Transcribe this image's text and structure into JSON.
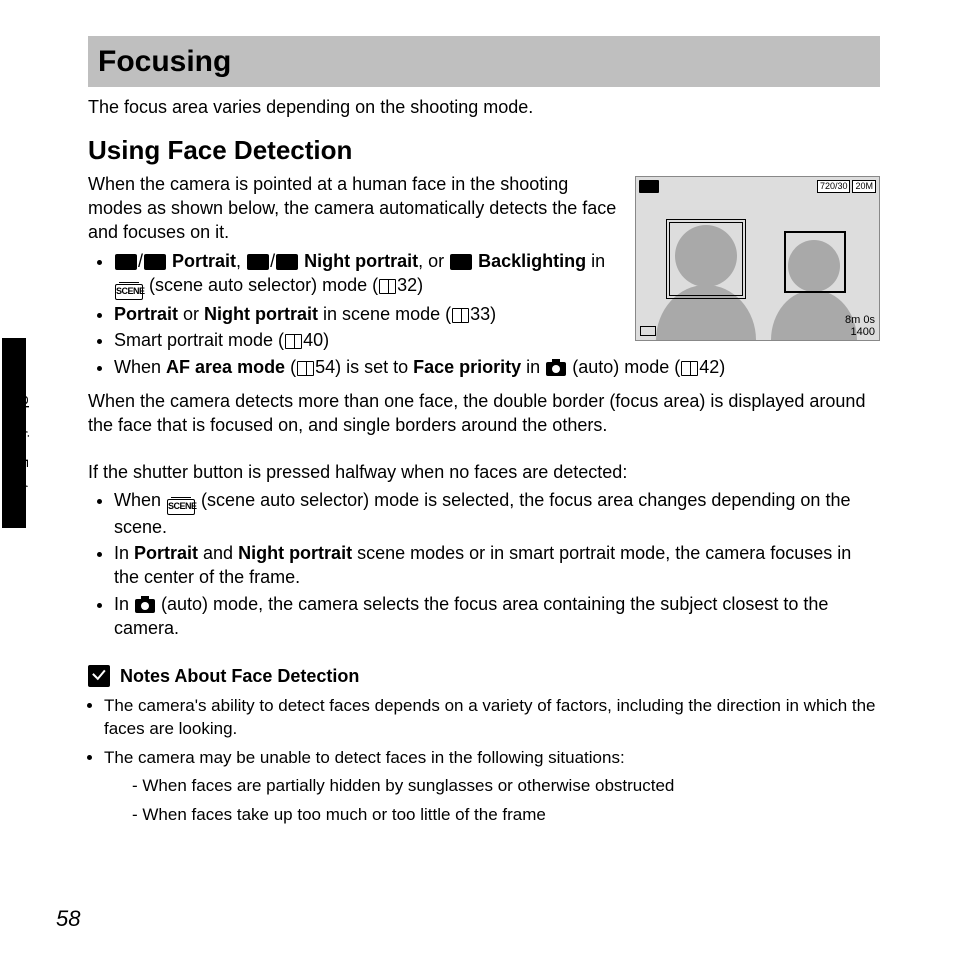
{
  "title": "Focusing",
  "intro": "The focus area varies depending on the shooting mode.",
  "subtitle": "Using Face Detection",
  "lead": "When the camera is pointed at a human face in the shooting modes as shown below, the camera automatically detects the face and focuses on it.",
  "bullets1": {
    "b1_a": " Portrait",
    "b1_b": " Night portrait",
    "b1_c": ", or ",
    "b1_d": "Backlighting",
    "b1_e": " in ",
    "b1_f": " (scene auto selector) mode (",
    "b1_g": "32)",
    "b2_a": "Portrait",
    "b2_b": " or ",
    "b2_c": "Night portrait",
    "b2_d": " in scene mode (",
    "b2_e": "33)",
    "b3_a": "Smart portrait mode (",
    "b3_b": "40)",
    "b4_a": "When ",
    "b4_b": "AF area mode",
    "b4_c": " (",
    "b4_d": "54) is set to ",
    "b4_e": "Face priority",
    "b4_f": " in ",
    "b4_g": " (auto) mode (",
    "b4_h": "42)"
  },
  "para2": "When the camera detects more than one face, the double border (focus area) is displayed around the face that is focused on, and single borders around the others.",
  "para3": "If the shutter button is pressed halfway when no faces are detected:",
  "bullets2": {
    "c1_a": "When ",
    "c1_b": " (scene auto selector) mode is selected, the focus area changes depending on the scene.",
    "c2_a": "In ",
    "c2_b": "Portrait",
    "c2_c": " and ",
    "c2_d": "Night portrait",
    "c2_e": " scene modes or in smart portrait mode, the camera focuses in the center of the frame.",
    "c3_a": "In ",
    "c3_b": " (auto) mode, the camera selects the focus area containing the subject closest to the camera."
  },
  "notes_title": "Notes About Face Detection",
  "notes": {
    "n1": "The camera's ability to detect faces depends on a variety of factors, including the direction in which the faces are looking.",
    "n2": "The camera may be unable to detect faces in the following situations:",
    "d1": "-  When faces are partially hidden by sunglasses or otherwise obstructed",
    "d2": "-  When faces take up too much or too little of the frame"
  },
  "lcd": {
    "tr1": "720/30",
    "tr2": "20M",
    "mid": "",
    "time": "8m 0s",
    "count": "1400"
  },
  "side_label": "Shooting Features",
  "page_number": "58"
}
